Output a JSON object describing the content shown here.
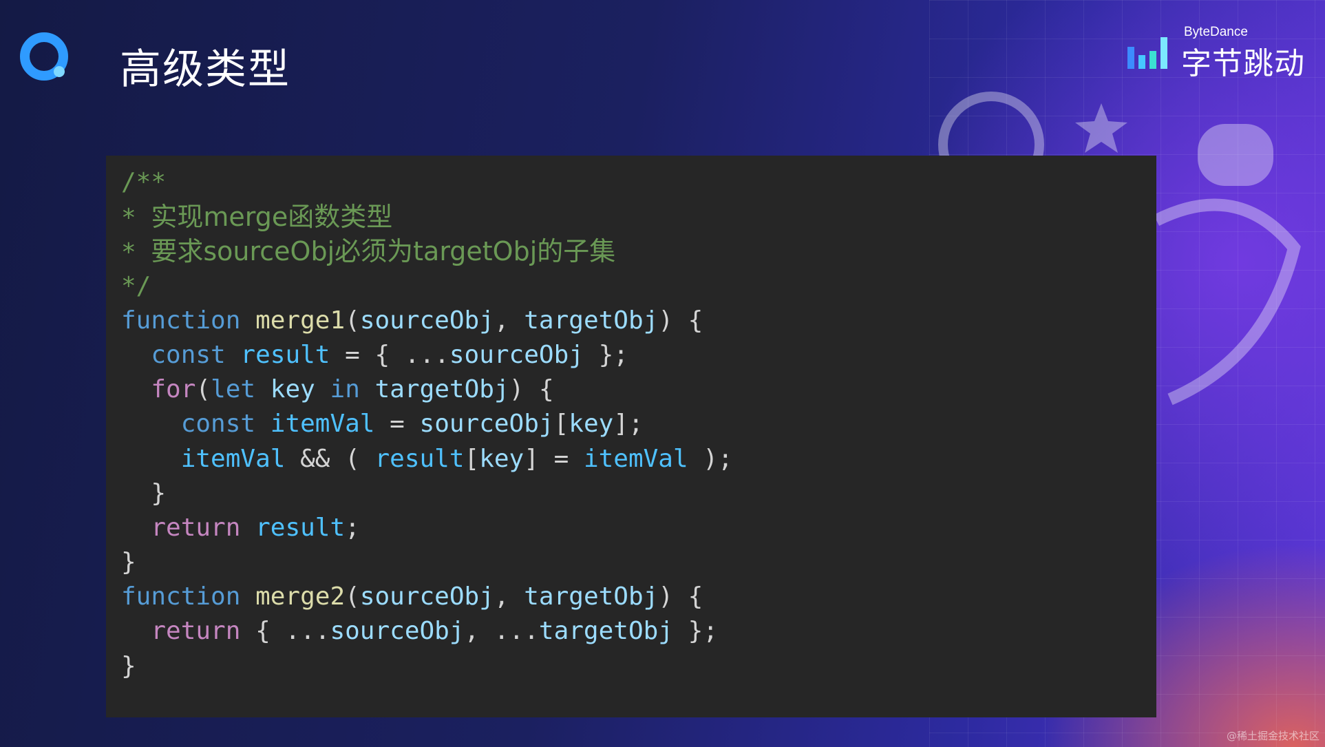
{
  "title": "高级类型",
  "brand": {
    "en": "ByteDance",
    "cn": "字节跳动"
  },
  "code": {
    "l1": "/**",
    "l2_star": "* ",
    "l2_text": "实现merge函数类型",
    "l3_star": "* ",
    "l3_text": "要求sourceObj必须为targetObj的子集",
    "l4": "*/",
    "function": "function",
    "merge1": "merge1",
    "merge2": "merge2",
    "const": "const",
    "for": "for",
    "let": "let",
    "in": "in",
    "return": "return",
    "result": "result",
    "sourceObj": "sourceObj",
    "targetObj": "targetObj",
    "key": "key",
    "itemVal": "itemVal"
  },
  "footer_watermark": "@稀土掘金技术社区",
  "colors": {
    "comment": "#6a9955",
    "keyword": "#569cd6",
    "control": "#c586c0",
    "function": "#dcdcaa",
    "variable": "#9cdcfe",
    "panel": "#262626"
  }
}
